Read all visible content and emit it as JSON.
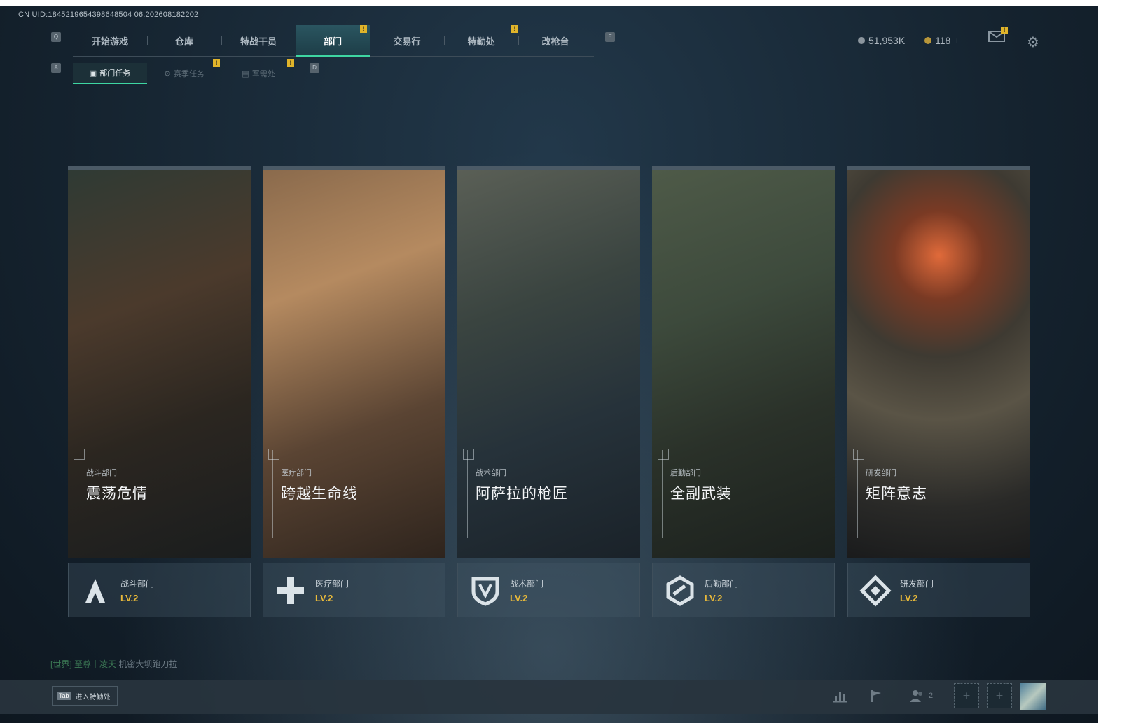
{
  "uid": "CN UID:1845219654398648504 06.202608182202",
  "key_hints": {
    "main_left": "Q",
    "main_right": "E",
    "sub_left": "A",
    "sub_right": "D"
  },
  "main_nav": [
    {
      "label": "开始游戏",
      "active": false,
      "alert": false
    },
    {
      "label": "仓库",
      "active": false,
      "alert": false
    },
    {
      "label": "特战干员",
      "active": false,
      "alert": false
    },
    {
      "label": "部门",
      "active": true,
      "alert": true
    },
    {
      "label": "交易行",
      "active": false,
      "alert": false
    },
    {
      "label": "特勤处",
      "active": false,
      "alert": true
    },
    {
      "label": "改枪台",
      "active": false,
      "alert": false
    }
  ],
  "sub_nav": [
    {
      "label": "部门任务",
      "icon": "task-icon",
      "active": true,
      "alert": false
    },
    {
      "label": "赛季任务",
      "icon": "gear-icon",
      "active": false,
      "alert": true
    },
    {
      "label": "军需处",
      "icon": "supply-icon",
      "active": false,
      "alert": true
    }
  ],
  "alert_mark": "!",
  "currency": {
    "silver": "51,953K",
    "gold": "118",
    "gold_add": "+"
  },
  "cards": [
    {
      "category": "战斗部门",
      "title": "震荡危情",
      "dept": "战斗部门",
      "level": "LV.2",
      "icon": "combat-dept-icon",
      "strip": "#3a4a56"
    },
    {
      "category": "医疗部门",
      "title": "跨越生命线",
      "dept": "医疗部门",
      "level": "LV.2",
      "icon": "medical-dept-icon",
      "strip": "#3a4a56"
    },
    {
      "category": "战术部门",
      "title": "阿萨拉的枪匠",
      "dept": "战术部门",
      "level": "LV.2",
      "icon": "tactical-dept-icon",
      "strip": "#3a4a56"
    },
    {
      "category": "后勤部门",
      "title": "全副武装",
      "dept": "后勤部门",
      "level": "LV.2",
      "icon": "logistics-dept-icon",
      "strip": "#3a4a56"
    },
    {
      "category": "研发部门",
      "title": "矩阵意志",
      "dept": "研发部门",
      "level": "LV.2",
      "icon": "research-dept-icon",
      "strip": "#3a4a56"
    }
  ],
  "chat": {
    "channel": "[世界]",
    "user": "至尊丨凌天",
    "message": "机密大坝跑刀拉"
  },
  "bottom": {
    "tab_key": "Tab",
    "tab_label": "进入特勤处",
    "squad_count": "2"
  },
  "colors": {
    "accent": "#3ed6a2",
    "level": "#e8b93a",
    "alert": "#e0b42a"
  }
}
